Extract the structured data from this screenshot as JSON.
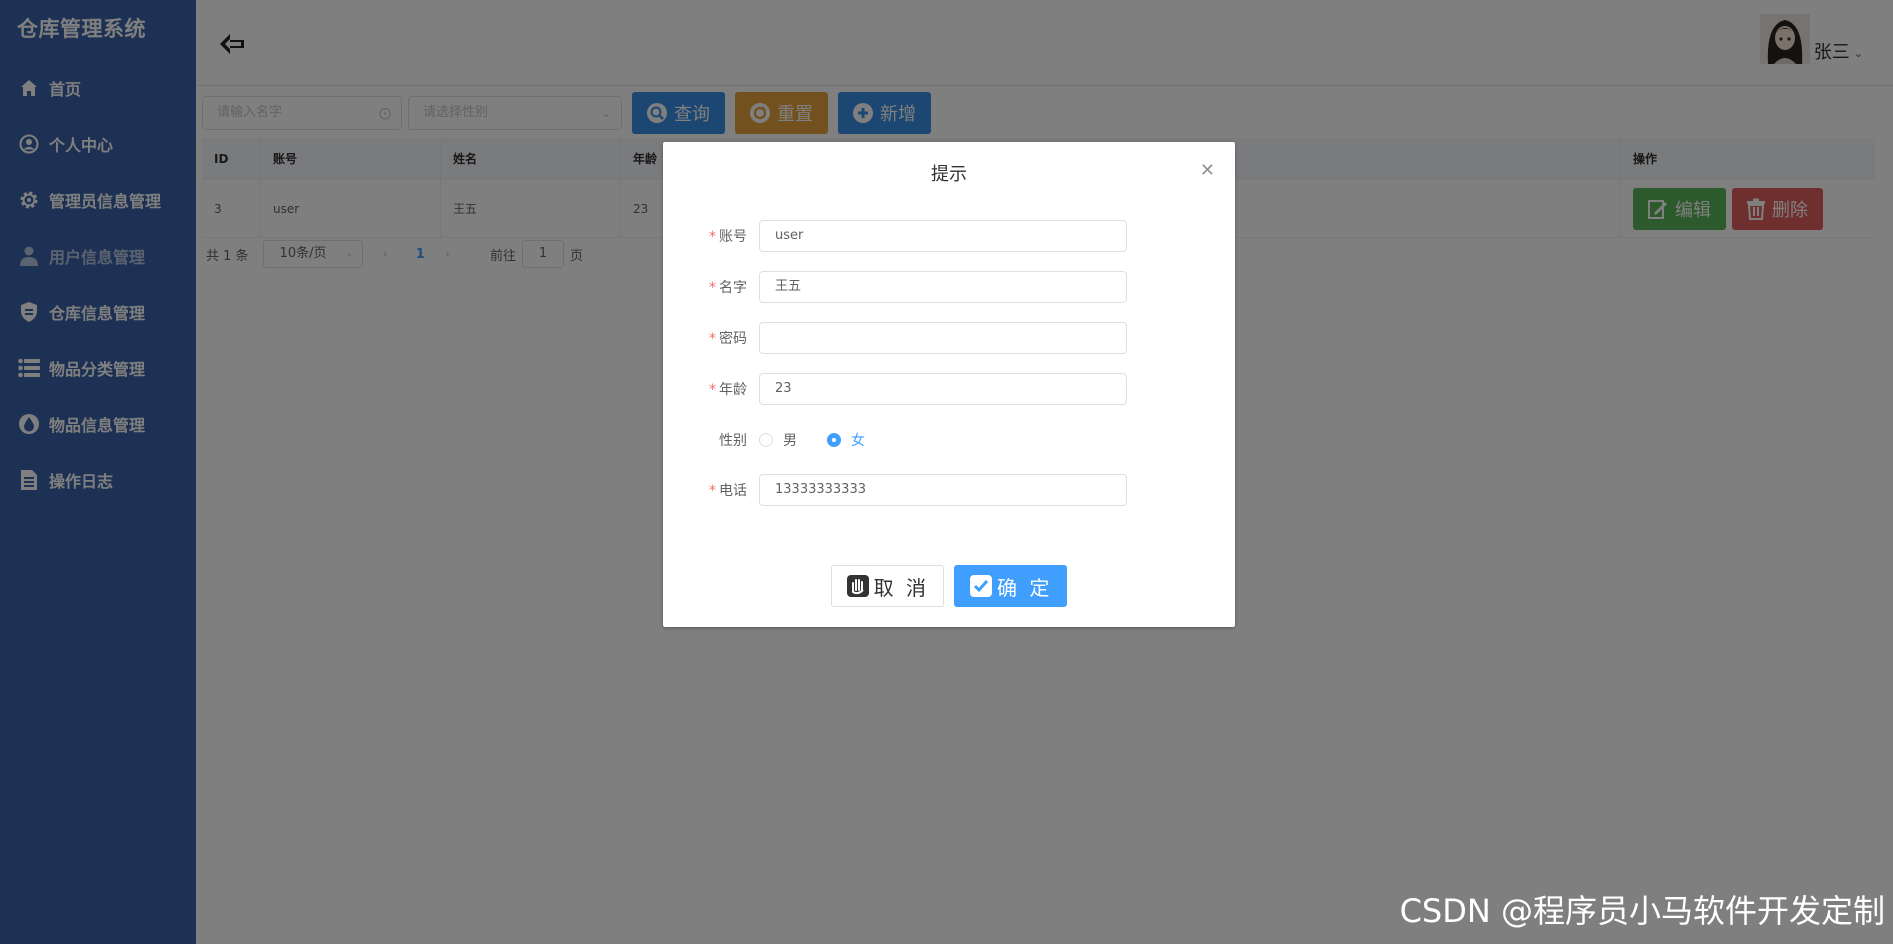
{
  "app": {
    "title": "仓库管理系统"
  },
  "sidebar": {
    "items": [
      {
        "label": "首页",
        "icon": "home-icon"
      },
      {
        "label": "个人中心",
        "icon": "person-icon"
      },
      {
        "label": "管理员信息管理",
        "icon": "gear-icon"
      },
      {
        "label": "用户信息管理",
        "icon": "user-icon",
        "active": true
      },
      {
        "label": "仓库信息管理",
        "icon": "shield-icon"
      },
      {
        "label": "物品分类管理",
        "icon": "list-icon"
      },
      {
        "label": "物品信息管理",
        "icon": "drop-icon"
      },
      {
        "label": "操作日志",
        "icon": "document-icon"
      }
    ]
  },
  "header": {
    "user_name": "张三"
  },
  "toolbar": {
    "name_placeholder": "请输入名字",
    "sex_placeholder": "请选择性别",
    "query_label": "查询",
    "reset_label": "重置",
    "add_label": "新增"
  },
  "table": {
    "columns": [
      "ID",
      "账号",
      "姓名",
      "年龄",
      "操作"
    ],
    "rows": [
      {
        "id": "3",
        "account": "user",
        "name": "王五",
        "age": "23"
      }
    ],
    "edit_label": "编辑",
    "delete_label": "删除"
  },
  "pager": {
    "total_text": "共 1 条",
    "page_size": "10条/页",
    "current_page": "1",
    "goto_prefix": "前往",
    "goto_value": "1",
    "goto_suffix": "页"
  },
  "dialog": {
    "title": "提示",
    "fields": {
      "account": {
        "label": "账号",
        "value": "user",
        "required": true
      },
      "name": {
        "label": "名字",
        "value": "王五",
        "required": true
      },
      "password": {
        "label": "密码",
        "value": "",
        "required": true
      },
      "age": {
        "label": "年龄",
        "value": "23",
        "required": true
      },
      "sex": {
        "label": "性别",
        "options": [
          "男",
          "女"
        ],
        "selected": "女"
      },
      "phone": {
        "label": "电话",
        "value": "13333333333",
        "required": true
      }
    },
    "cancel_label": "取 消",
    "ok_label": "确 定"
  },
  "watermark": "CSDN @程序员小马软件开发定制",
  "colors": {
    "sidebar": "#3b62a8",
    "primary": "#409eff",
    "warning": "#e6a23c",
    "success": "#5bb55b",
    "danger": "#e15f5f",
    "required": "#f56c6c"
  }
}
